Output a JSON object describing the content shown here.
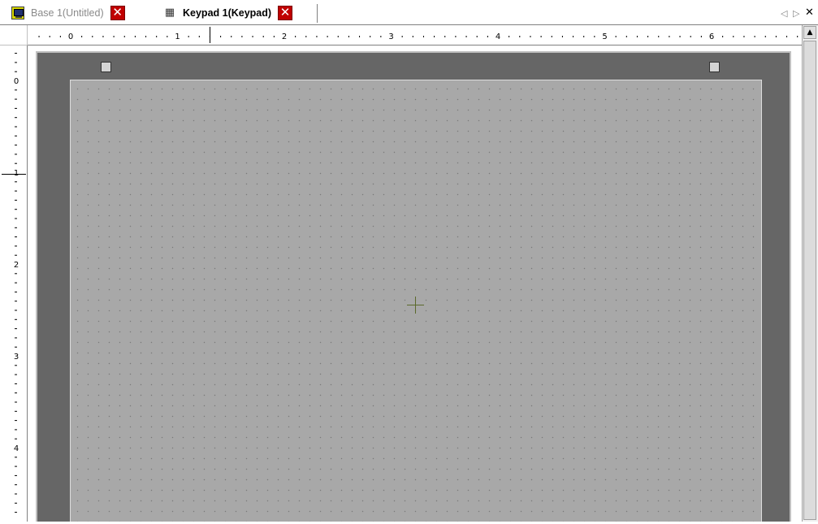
{
  "tabs": [
    {
      "label": "Base 1(Untitled)",
      "icon": "monitor-icon",
      "active": false,
      "close": "✕"
    },
    {
      "label": "Keypad 1(Keypad)",
      "icon": "keypad-icon",
      "active": true,
      "close": "✕"
    }
  ],
  "tab_nav": {
    "left": "◁",
    "right": "▷",
    "close": "✕"
  },
  "ruler": {
    "h_labels": [
      "0",
      "1",
      "2",
      "3",
      "4",
      "5",
      "6"
    ],
    "v_labels": [
      "0",
      "1",
      "2",
      "3",
      "4"
    ]
  },
  "scrollbar": {
    "up_arrow": "▲"
  },
  "colors": {
    "close_button": "#c00000",
    "screen_frame": "#666666",
    "keypad_surface": "#a8a8a8",
    "crosshair": "#5c6a2c"
  }
}
